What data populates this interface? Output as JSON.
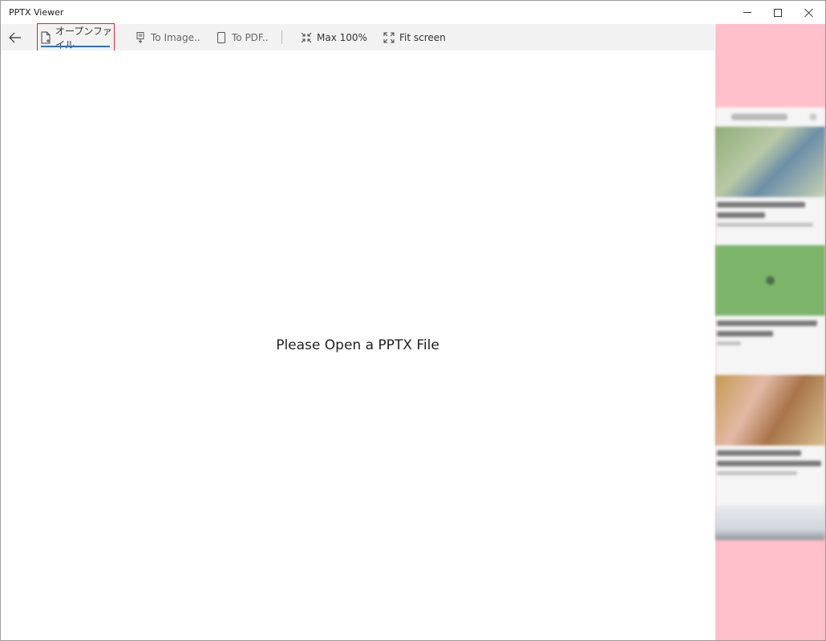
{
  "window": {
    "title": "PPTX Viewer"
  },
  "toolbar": {
    "open_label": "オープンファイル",
    "to_image_label": "To Image..",
    "to_pdf_label": "To PDF..",
    "max_label": "Max 100%",
    "fit_label": "Fit screen"
  },
  "main": {
    "placeholder": "Please Open a PPTX File"
  },
  "colors": {
    "highlight_border": "#e0262b",
    "underline_accent": "#2f6fbf",
    "ad_background": "#ffc0cb",
    "toolbar_background": "#f2f2f2"
  },
  "icons": {
    "back": "back-arrow-icon",
    "open": "new-file-icon",
    "to_image": "image-export-icon",
    "to_pdf": "document-icon",
    "max": "collapse-arrows-icon",
    "fit": "expand-arrows-icon"
  }
}
